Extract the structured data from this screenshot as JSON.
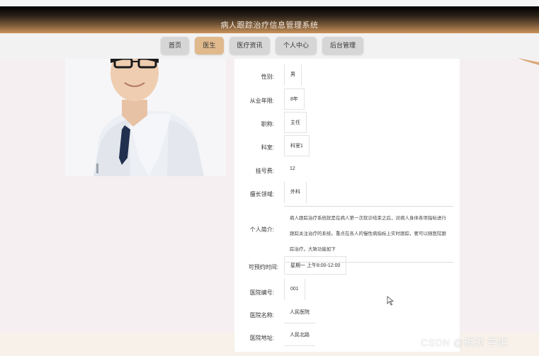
{
  "app": {
    "title": "病人跟踪治疗信息管理系统"
  },
  "nav": [
    {
      "label": "首页",
      "active": false
    },
    {
      "label": "医生",
      "active": true
    },
    {
      "label": "医疗资讯",
      "active": false
    },
    {
      "label": "个人中心",
      "active": false
    },
    {
      "label": "后台管理",
      "active": false
    }
  ],
  "doctor": {
    "fields": [
      {
        "label": "性别:",
        "value": "男"
      },
      {
        "label": "从业年限:",
        "value": "8年"
      },
      {
        "label": "职称:",
        "value": "主任"
      },
      {
        "label": "科室:",
        "value": "科室1"
      },
      {
        "label": "挂号费:",
        "value": "12"
      },
      {
        "label": "擅长领域:",
        "value": "外科"
      }
    ],
    "intro_label": "个人简介:",
    "intro_text": "病人跟踪治疗系统就是在病人第一次就诊结束之后，对病人身体各项指标进行跟踪关注治疗的系统。重点在各人的慢性病指标上实时跟踪，要可以随医院跟踪治疗。大致功能如下",
    "fields_after": [
      {
        "label": "可预约时间:",
        "value": "星期一 上午8:00-12:00",
        "boxed": true
      },
      {
        "label": "医院编号:",
        "value": "001",
        "boxed": false
      },
      {
        "label": "医院名称:",
        "value": "人民医院",
        "boxed": false
      },
      {
        "label": "医院地址:",
        "value": "人民北路",
        "boxed": false
      }
    ]
  },
  "watermark": "CSDN @琪琪 学姐",
  "colors": {
    "nav_active": "#e0b98d",
    "nav_default": "#d6d6d6",
    "accent": "#d9a877"
  }
}
